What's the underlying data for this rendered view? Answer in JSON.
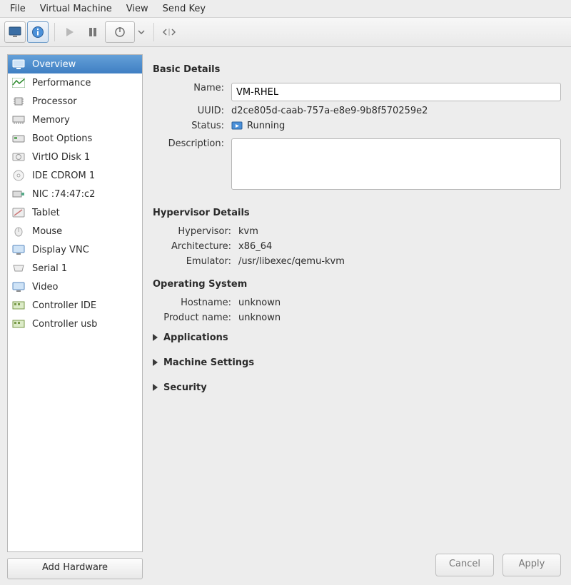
{
  "menu": {
    "file": "File",
    "vm": "Virtual Machine",
    "view": "View",
    "sendkey": "Send Key"
  },
  "sidebar": {
    "items": [
      {
        "label": "Overview"
      },
      {
        "label": "Performance"
      },
      {
        "label": "Processor"
      },
      {
        "label": "Memory"
      },
      {
        "label": "Boot Options"
      },
      {
        "label": "VirtIO Disk 1"
      },
      {
        "label": "IDE CDROM 1"
      },
      {
        "label": "NIC :74:47:c2"
      },
      {
        "label": "Tablet"
      },
      {
        "label": "Mouse"
      },
      {
        "label": "Display VNC"
      },
      {
        "label": "Serial 1"
      },
      {
        "label": "Video"
      },
      {
        "label": "Controller IDE"
      },
      {
        "label": "Controller usb"
      }
    ],
    "add_hw": "Add Hardware"
  },
  "details": {
    "basic_title": "Basic Details",
    "name_lbl": "Name:",
    "name_val": "VM-RHEL",
    "uuid_lbl": "UUID:",
    "uuid_val": "d2ce805d-caab-757a-e8e9-9b8f570259e2",
    "status_lbl": "Status:",
    "status_val": "Running",
    "desc_lbl": "Description:",
    "desc_val": "",
    "hyp_title": "Hypervisor Details",
    "hyp_lbl": "Hypervisor:",
    "hyp_val": "kvm",
    "arch_lbl": "Architecture:",
    "arch_val": "x86_64",
    "emu_lbl": "Emulator:",
    "emu_val": "/usr/libexec/qemu-kvm",
    "os_title": "Operating System",
    "host_lbl": "Hostname:",
    "host_val": "unknown",
    "prod_lbl": "Product name:",
    "prod_val": "unknown",
    "exp_apps": "Applications",
    "exp_mach": "Machine Settings",
    "exp_sec": "Security"
  },
  "footer": {
    "cancel": "Cancel",
    "apply": "Apply"
  }
}
